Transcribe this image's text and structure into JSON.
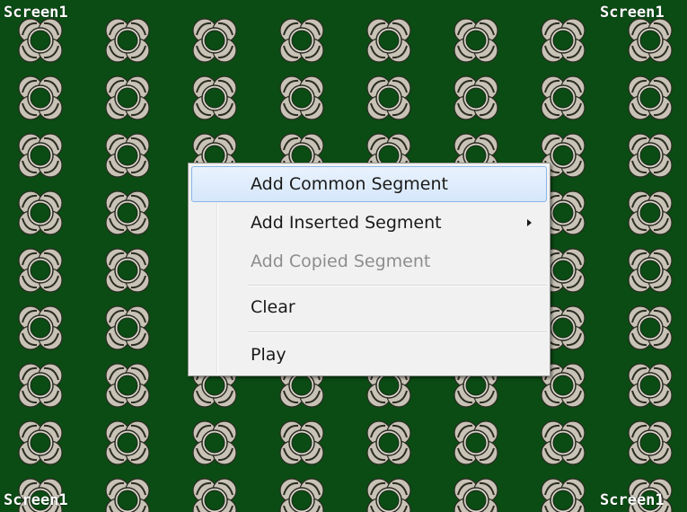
{
  "window": {
    "corner_labels": {
      "top_left": "Screen1",
      "top_right": "Screen1",
      "bottom_left": "Screen1",
      "bottom_right": "Screen1"
    },
    "background_color": "#0b4b14",
    "pattern_color": "#c9c4b8",
    "pattern_icon": "four-petal-flower-tile"
  },
  "context_menu": {
    "items": [
      {
        "label": "Add Common Segment",
        "state": "highlighted"
      },
      {
        "label": "Add Inserted Segment",
        "state": "normal",
        "submenu": true
      },
      {
        "label": "Add Copied Segment",
        "state": "disabled"
      },
      {
        "label": "Clear",
        "state": "normal"
      },
      {
        "label": "Play",
        "state": "normal"
      }
    ],
    "highlight_color": "#d6e7fb",
    "highlight_border": "#8ab5e8",
    "disabled_text_color": "#8d8d8d"
  }
}
